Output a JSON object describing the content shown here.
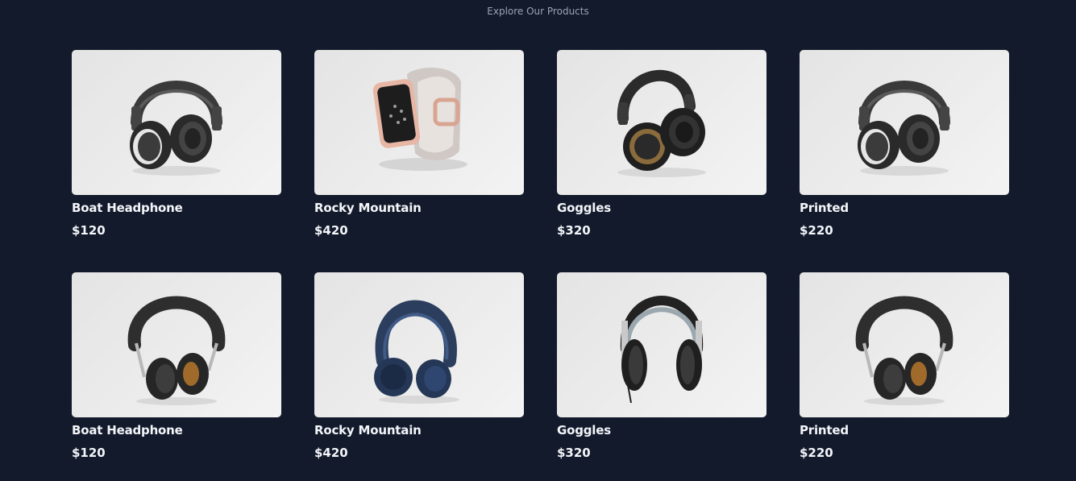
{
  "header": {
    "subtitle": "Explore Our Products"
  },
  "products": [
    {
      "name": "Boat Headphone",
      "price": "$120",
      "image_icon": "headphones-black-icon"
    },
    {
      "name": "Rocky Mountain",
      "price": "$420",
      "image_icon": "smartwatch-rose-gold-icon"
    },
    {
      "name": "Goggles",
      "price": "$320",
      "image_icon": "headphones-bronze-icon"
    },
    {
      "name": "Printed",
      "price": "$220",
      "image_icon": "headphones-black-icon"
    },
    {
      "name": "Boat Headphone",
      "price": "$120",
      "image_icon": "headphones-studio-icon"
    },
    {
      "name": "Rocky Mountain",
      "price": "$420",
      "image_icon": "headphones-navy-icon"
    },
    {
      "name": "Goggles",
      "price": "$320",
      "image_icon": "headphones-dj-silver-icon"
    },
    {
      "name": "Printed",
      "price": "$220",
      "image_icon": "headphones-studio-icon"
    }
  ],
  "colors": {
    "background": "#131a2b",
    "card_image_bg": "#ececec",
    "text_primary": "#f3f5f9",
    "text_muted": "#9aa3b3"
  }
}
